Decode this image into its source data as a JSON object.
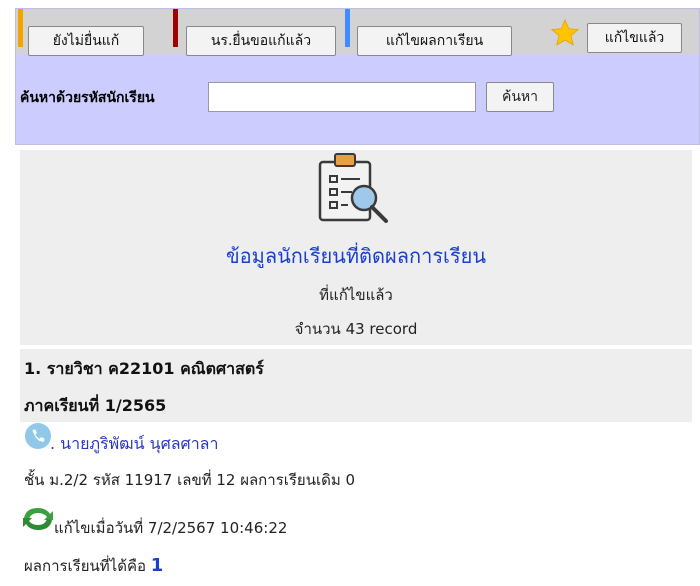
{
  "tabs": [
    {
      "label": "ยังไม่ยื่นแก้",
      "marker_color": "#f5a300"
    },
    {
      "label": "นร.ยื่นขอแก้แล้ว",
      "marker_color": "#a00000"
    },
    {
      "label": "แก้ไขผลกาเรียน",
      "marker_color": "#3f8cff"
    },
    {
      "label": "แก้ไขแล้ว",
      "icon": "star-icon"
    }
  ],
  "search": {
    "label": "ค้นหาด้วยรหัสนักเรียน",
    "value": "",
    "button_label": "ค้นหา"
  },
  "summary": {
    "icon": "clipboard-search-icon",
    "title": "ข้อมูลนักเรียนที่ติดผลการเรียน",
    "subtitle": "ที่แก้ไขแล้ว",
    "count": "จำนวน 43 record"
  },
  "record": {
    "subject": "1. รายวิชา ค22101 คณิตศาสตร์",
    "semester": "ภาคเรียนที่ 1/2565",
    "student_name": ". นายภูริพัฒน์ นุศลศาลา",
    "details": "ชั้น ม.2/2 รหัส 11917 เลขที่ 12 ผลการเรียนเดิม 0",
    "edited_label": "แก้ไขเมื่อวันที่ 7/2/2567 10:46:22",
    "result_label": "ผลการเรียนที่ได้คือ",
    "result_value": "1"
  },
  "colors": {
    "panel_bg": "#ccccff",
    "tab_row_bg": "#d3d3d3",
    "title_blue": "#1a3fcf",
    "star": "#ffc400"
  }
}
